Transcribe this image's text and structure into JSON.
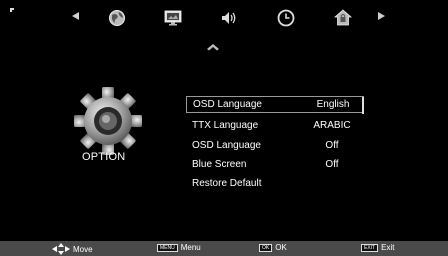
{
  "top_tabs": [
    {
      "icon": "channel-globe-icon"
    },
    {
      "icon": "picture-monitor-icon"
    },
    {
      "icon": "sound-speaker-icon"
    },
    {
      "icon": "time-clock-icon"
    },
    {
      "icon": "lock-house-icon"
    }
  ],
  "section": {
    "title": "OPTION",
    "icon": "gear-icon"
  },
  "menu": {
    "items": [
      {
        "label": "OSD Language",
        "value": "English",
        "selected": true
      },
      {
        "label": "TTX Language",
        "value": "ARABIC",
        "selected": false
      },
      {
        "label": "OSD Language",
        "value": "Off",
        "selected": false
      },
      {
        "label": "Blue Screen",
        "value": "Off",
        "selected": false
      },
      {
        "label": "Restore Default",
        "value": "",
        "selected": false
      }
    ]
  },
  "footer": {
    "move": {
      "label": "Move"
    },
    "menu": {
      "key": "MENU",
      "label": "Menu"
    },
    "ok": {
      "key": "OK",
      "label": "OK"
    },
    "exit": {
      "key": "EXIT",
      "label": "Exit"
    }
  },
  "colors": {
    "background": "#000000",
    "footer_bar": "#4a4a4a",
    "text": "#ffffff",
    "highlight_border": "#999999"
  }
}
